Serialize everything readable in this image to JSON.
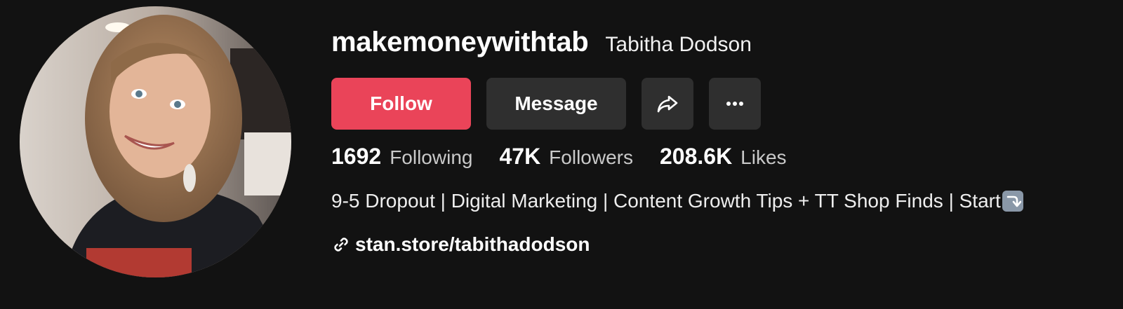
{
  "profile": {
    "username": "makemoneywithtab",
    "display_name": "Tabitha Dodson",
    "avatar_icon": "profile-photo"
  },
  "actions": {
    "follow_label": "Follow",
    "message_label": "Message",
    "share_icon": "share-arrow-icon",
    "more_icon": "more-dots-icon"
  },
  "stats": [
    {
      "value": "1692",
      "label": "Following"
    },
    {
      "value": "47K",
      "label": "Followers"
    },
    {
      "value": "208.6K",
      "label": "Likes"
    }
  ],
  "bio": {
    "text": "9-5 Dropout | Digital Marketing | Content Growth Tips + TT Shop Finds | Start",
    "emoji_icon": "arrow-down-emoji-icon"
  },
  "link": {
    "text": "stan.store/tabithadodson",
    "icon": "link-icon"
  },
  "colors": {
    "background": "#121212",
    "follow_button": "#ea4459",
    "secondary_button": "#2f2f2f"
  }
}
